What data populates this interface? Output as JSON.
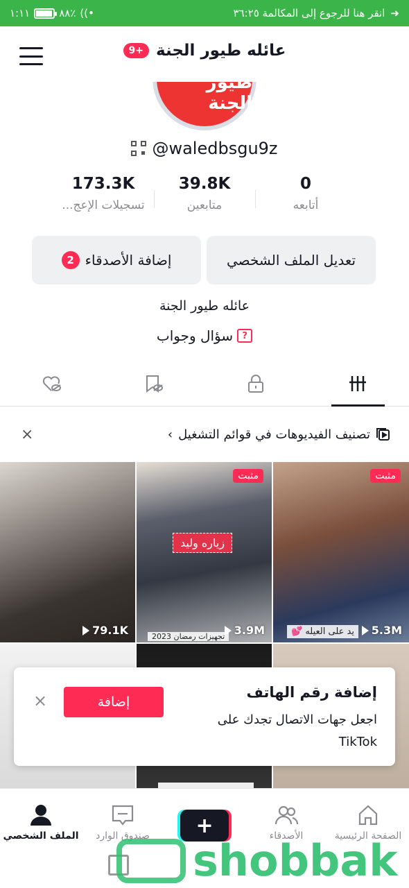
{
  "status_bar": {
    "time": "١:١١",
    "battery": "٨٨٪",
    "battery_level": 0.88,
    "call_banner": "انقر هنا للرجوع إلى المكالمة ٣٦:٢٥"
  },
  "header": {
    "title": "عائله طيور الجنة",
    "notification_badge": "9+",
    "menu_icon": "hamburger-menu-icon"
  },
  "profile": {
    "avatar_text": "طيور الجنة",
    "username": "@waledbsgu9z",
    "stats": [
      {
        "value": "0",
        "label": "أتابعه"
      },
      {
        "value": "39.8K",
        "label": "متابعين"
      },
      {
        "value": "173.3K",
        "label": "تسجيلات الإعج..."
      }
    ],
    "edit_profile_label": "تعديل الملف الشخصي",
    "add_friends_label": "إضافة الأصدقاء",
    "add_friends_count": "2",
    "bio": "عائله طيور الجنة",
    "qa_label": "سؤال وجواب",
    "qa_icon_glyph": "?"
  },
  "tabs": [
    {
      "icon": "videos-grid-icon",
      "active": true
    },
    {
      "icon": "lock-icon",
      "active": false
    },
    {
      "icon": "bookmark-hidden-icon",
      "active": false
    },
    {
      "icon": "liked-hidden-icon",
      "active": false
    }
  ],
  "playlist_bar": {
    "label": "تصنيف الفيديوهات في قوائم التشغيل",
    "chevron": "›"
  },
  "videos": [
    {
      "views": "5.3M",
      "pinned": true,
      "pinned_label": "مثبت",
      "caption": "يد على العيله 💕"
    },
    {
      "views": "3.9M",
      "pinned": true,
      "pinned_label": "مثبت",
      "sticker": "زياره وليد",
      "caption": "تجهيزات رمضان 2023"
    },
    {
      "views": "79.1K",
      "pinned": false
    }
  ],
  "popup": {
    "title": "إضافة رقم الهاتف",
    "body": "اجعل جهات الاتصال تجدك على TikTok",
    "add_button": "إضافة",
    "close": "×"
  },
  "bottom_nav": {
    "home": "الصفحة الرئيسية",
    "friends": "الأصدقاء",
    "create": "+",
    "inbox": "صندوق الوارد",
    "profile": "الملف الشخصي"
  },
  "watermark": {
    "text": "shobbak"
  },
  "colors": {
    "accent": "#fe2c55",
    "status_bar": "#3bb54a",
    "text": "#161823",
    "muted": "#8a8b91"
  }
}
